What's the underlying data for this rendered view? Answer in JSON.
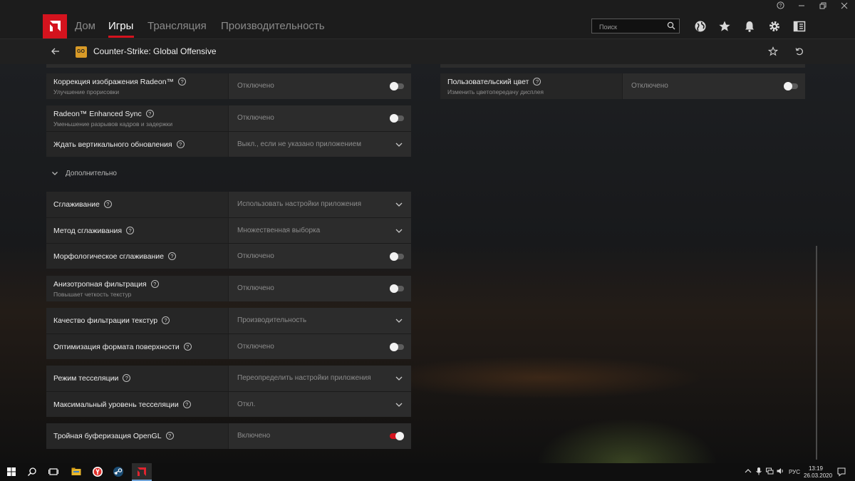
{
  "nav": {
    "tabs": [
      {
        "label": "Дом"
      },
      {
        "label": "Игры"
      },
      {
        "label": "Трансляция"
      },
      {
        "label": "Производительность"
      }
    ],
    "search_placeholder": "Поиск",
    "accent": "#d4131e"
  },
  "game": {
    "title": "Counter-Strike: Global Offensive",
    "icon_text": "GO"
  },
  "left_groups": [
    {
      "rows": [
        {
          "label": "Коррекция изображения Radeon™",
          "sub": "Улучшение прорисовки",
          "value": "Отключено",
          "control": "toggle",
          "on": false
        }
      ]
    },
    {
      "rows": [
        {
          "label": "Radeon™ Enhanced Sync",
          "sub": "Уменьшение разрывов кадров и задержки",
          "value": "Отключено",
          "control": "toggle",
          "on": false
        },
        {
          "label": "Ждать вертикального обновления",
          "value": "Выкл., если не указано приложением",
          "control": "dropdown"
        }
      ]
    },
    {
      "rows": [
        {
          "label": "Сглаживание",
          "value": "Использовать настройки приложения",
          "control": "dropdown"
        },
        {
          "label": "Метод сглаживания",
          "value": "Множественная выборка",
          "control": "dropdown"
        },
        {
          "label": "Морфологическое сглаживание",
          "value": "Отключено",
          "control": "toggle",
          "on": false
        }
      ]
    },
    {
      "rows": [
        {
          "label": "Анизотропная фильтрация",
          "sub": "Повышает четкость текстур",
          "value": "Отключено",
          "control": "toggle",
          "on": false
        }
      ]
    },
    {
      "rows": [
        {
          "label": "Качество фильтрации текстур",
          "value": "Производительность",
          "control": "dropdown"
        },
        {
          "label": "Оптимизация формата поверхности",
          "value": "Отключено",
          "control": "toggle",
          "on": false
        }
      ]
    },
    {
      "rows": [
        {
          "label": "Режим тесселяции",
          "value": "Переопределить настройки приложения",
          "control": "dropdown"
        },
        {
          "label": "Максимальный уровень тесселяции",
          "value": "Откл.",
          "control": "dropdown"
        }
      ]
    },
    {
      "rows": [
        {
          "label": "Тройная буферизация OpenGL",
          "value": "Включено",
          "control": "toggle",
          "on": true
        }
      ]
    }
  ],
  "section_label": "Дополнительно",
  "right_groups": [
    {
      "rows": [
        {
          "label": "Пользовательский цвет",
          "sub": "Изменить цветопередачу дисплея",
          "value": "Отключено",
          "control": "toggle",
          "on": false
        }
      ]
    }
  ],
  "taskbar": {
    "lang": "РУС",
    "time": "13:19",
    "date": "26.03.2020"
  }
}
